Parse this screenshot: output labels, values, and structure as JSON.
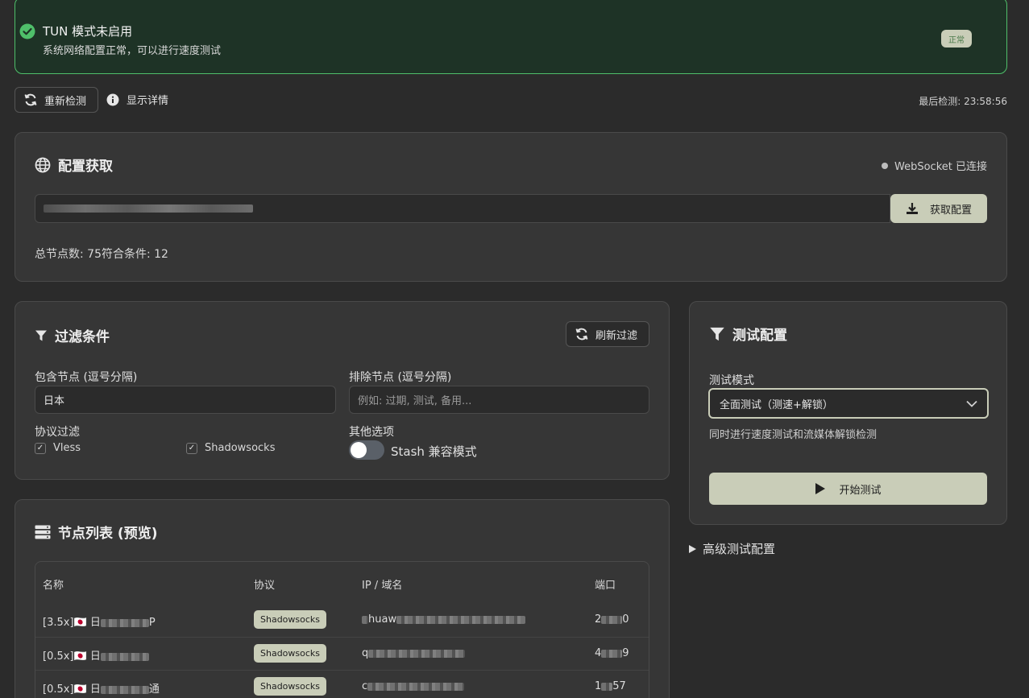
{
  "banner": {
    "title": "TUN 模式未启用",
    "subtitle": "系统网络配置正常，可以进行速度测试",
    "badge": "正常",
    "accent_color": "#4fbf6a"
  },
  "actions": {
    "recheck_label": "重新检测",
    "details_label": "显示详情",
    "last_check": "最后检测: 23:58:56"
  },
  "config": {
    "title": "配置获取",
    "icon": "globe-icon",
    "ws_status": "WebSocket 已连接",
    "url_value": "",
    "fetch_label": "获取配置",
    "totals": "总节点数: 75符合条件: 12"
  },
  "filters": {
    "title": "过滤条件",
    "refresh_label": "刷新过滤",
    "include_label": "包含节点 (逗号分隔)",
    "include_value": "日本",
    "exclude_label": "排除节点 (逗号分隔)",
    "exclude_placeholder": "例如: 过期, 测试, 备用...",
    "protocol_label": "协议过滤",
    "protocols": [
      "Vless",
      "Shadowsocks"
    ],
    "other_label": "其他选项",
    "stash_label": "Stash 兼容模式"
  },
  "test_config": {
    "title": "测试配置",
    "mode_label": "测试模式",
    "mode_value": "全面测试（测速+解锁）",
    "mode_hint": "同时进行速度测试和流媒体解锁检测",
    "start_label": "开始测试",
    "advanced_label": "高级测试配置"
  },
  "node_list": {
    "title": "节点列表 (预览)",
    "columns": [
      "名称",
      "协议",
      "IP / 域名",
      "端口"
    ],
    "rows": [
      {
        "name": "[3.5x]🇯🇵 日",
        "name_tail": "P",
        "protocol": "Shadowsocks",
        "host": "huaw",
        "port_head": "2",
        "port_tail": "0"
      },
      {
        "name": "[0.5x]🇯🇵 日",
        "name_tail": "",
        "protocol": "Shadowsocks",
        "host": "q",
        "port_head": "4",
        "port_tail": "9"
      },
      {
        "name": "[0.5x]🇯🇵 日",
        "name_tail": "通",
        "protocol": "Shadowsocks",
        "host": "c",
        "port_head": "1",
        "port_tail": "57"
      }
    ]
  }
}
